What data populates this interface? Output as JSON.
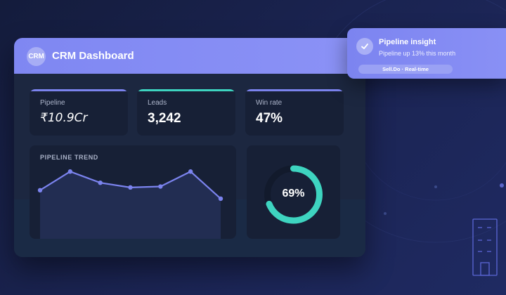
{
  "header": {
    "logo_text": "CRM",
    "title": "CRM Dashboard"
  },
  "kpis": [
    {
      "label": "Pipeline",
      "value": "₹10.9Cr",
      "accent": "#7b83ee"
    },
    {
      "label": "Leads",
      "value": "3,242",
      "accent": "#3ed4c0"
    },
    {
      "label": "Win rate",
      "value": "47%",
      "accent": "#7b83ee"
    }
  ],
  "trend": {
    "title": "PIPELINE TREND"
  },
  "chart_data": {
    "type": "area",
    "values": [
      52,
      72,
      60,
      55,
      56,
      72,
      43
    ],
    "ylim": [
      0,
      100
    ],
    "color": "#7b83ee"
  },
  "gauge": {
    "value_text": "69%",
    "value": 0.69,
    "color": "#3ed4c0"
  },
  "toast": {
    "title": "Pipeline insight",
    "subtitle": "Pipeline up 13% this month",
    "pill": "Sell.Do · Real-time",
    "icon": "check-icon"
  },
  "colors": {
    "accent": "#7b83ee",
    "teal": "#3ed4c0",
    "background": "#1a2350"
  }
}
